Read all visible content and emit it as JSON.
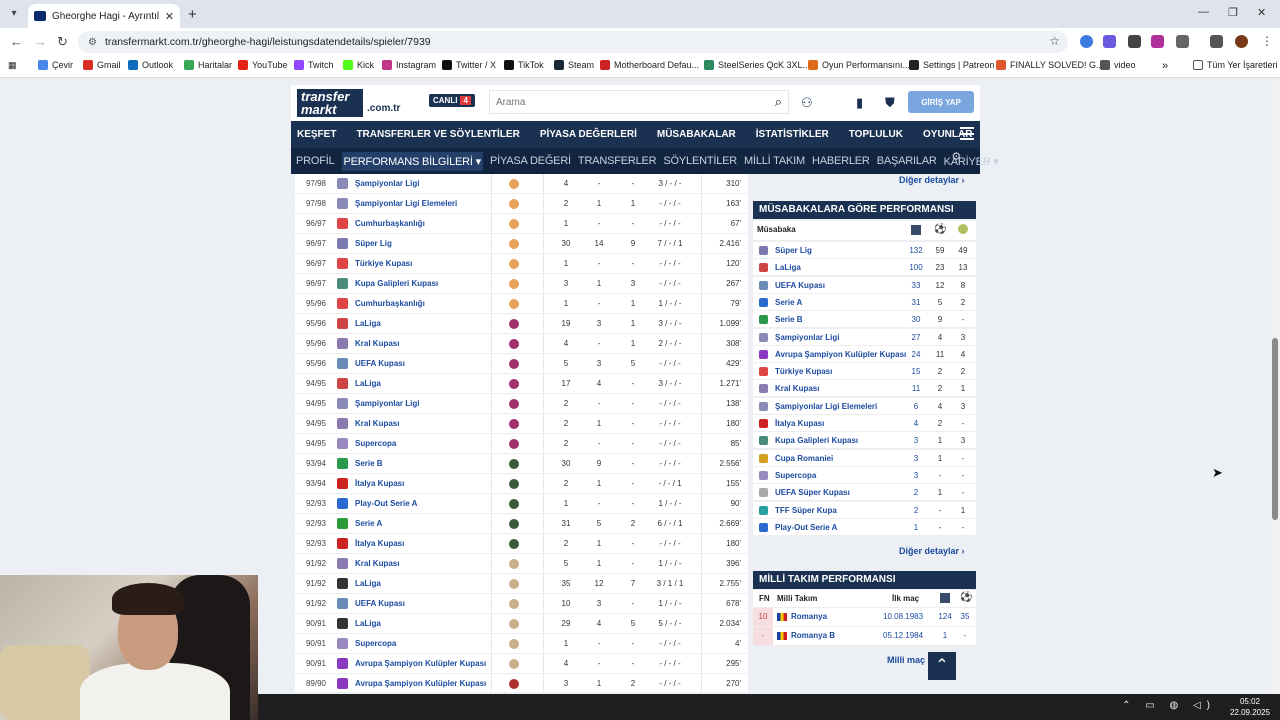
{
  "browser": {
    "tab_title": "Gheorghe Hagi - Ayrıntılı perfo",
    "url": "transfermarkt.com.tr/gheorghe-hagi/leistungsdatendetails/spieler/7939",
    "bookmarks": [
      "Çevir",
      "Gmail",
      "Outlook",
      "Haritalar",
      "YouTube",
      "Twitch",
      "Kick",
      "Instagram",
      "Twitter / X",
      "TikTok",
      "Steam",
      "Motherboard Defau...",
      "SteelSeries QcK 3XL...",
      "Oyun Performansını...",
      "Settings | Patreon",
      "FINALLY SOLVED! G...",
      "video"
    ],
    "more_bookmarks": "»",
    "all_bookmarks": "Tüm Yer İşaretleri",
    "bookmark_colors": [
      "#4a86e8",
      "#d93025",
      "#0f6cbd",
      "#34a853",
      "#e62117",
      "#9146ff",
      "#53fc18",
      "#c13584",
      "#111111",
      "#111111",
      "#1b2838",
      "#cc2222",
      "#2a8a5e",
      "#e06a1c",
      "#222222",
      "#e0562a",
      "#555555"
    ]
  },
  "header": {
    "logo": "transfer markt",
    "logo_domain": ".com.tr",
    "live": "CANLI",
    "live_count": "4",
    "search_placeholder": "Arama",
    "login": "GİRİŞ YAP"
  },
  "main_nav": [
    "KEŞFET",
    "TRANSFERLER VE SÖYLENTİLER",
    "PİYASA DEĞERLERİ",
    "MÜSABAKALAR",
    "İSTATİSTİKLER",
    "TOPLULUK",
    "OYUNLAR"
  ],
  "sub_nav": [
    "PROFİL",
    "PERFORMANS BİLGİLERİ ▾",
    "PİYASA DEĞERİ",
    "TRANSFERLER",
    "SÖYLENTİLER",
    "MİLLİ TAKIM",
    "HABERLER",
    "BAŞARILAR",
    "KARİYER ▾"
  ],
  "season_rows": [
    {
      "season": "97/98",
      "comp": "Şampiyonlar Ligi",
      "icon": "#8a8ab8",
      "club": "#e8a25a",
      "apps": "4",
      "goals": "-",
      "assists": "-",
      "cards": "3 / - / -",
      "mins": "310'"
    },
    {
      "season": "97/98",
      "comp": "Şampiyonlar Ligi Elemeleri",
      "icon": "#8a8ab8",
      "club": "#e8a25a",
      "apps": "2",
      "goals": "1",
      "assists": "1",
      "cards": "- / - / -",
      "mins": "163'"
    },
    {
      "season": "96/97",
      "comp": "Cumhurbaşkanlığı",
      "icon": "#d44",
      "club": "#e8a25a",
      "apps": "1",
      "goals": "-",
      "assists": "-",
      "cards": "- / - / -",
      "mins": "67'"
    },
    {
      "season": "96/97",
      "comp": "Süper Lig",
      "icon": "#7a7ab0",
      "club": "#e8a25a",
      "apps": "30",
      "goals": "14",
      "assists": "9",
      "cards": "7 / - / 1",
      "mins": "2.416'"
    },
    {
      "season": "96/97",
      "comp": "Türkiye Kupası",
      "icon": "#d44",
      "club": "#e8a25a",
      "apps": "1",
      "goals": "-",
      "assists": "-",
      "cards": "- / - / -",
      "mins": "120'"
    },
    {
      "season": "96/97",
      "comp": "Kupa Galipleri Kupası",
      "icon": "#4a8a7a",
      "club": "#e8a25a",
      "apps": "3",
      "goals": "1",
      "assists": "3",
      "cards": "- / - / -",
      "mins": "267'"
    },
    {
      "season": "95/96",
      "comp": "Cumhurbaşkanlığı",
      "icon": "#d44",
      "club": "#e8a25a",
      "apps": "1",
      "goals": "-",
      "assists": "1",
      "cards": "1 / - / -",
      "mins": "79'"
    },
    {
      "season": "95/96",
      "comp": "LaLiga",
      "icon": "#c44",
      "club": "#a0306a",
      "apps": "19",
      "goals": "3",
      "assists": "1",
      "cards": "3 / - / -",
      "mins": "1.099'"
    },
    {
      "season": "95/96",
      "comp": "Kral Kupası",
      "icon": "#8a7ab0",
      "club": "#a0306a",
      "apps": "4",
      "goals": "-",
      "assists": "1",
      "cards": "2 / - / -",
      "mins": "308'"
    },
    {
      "season": "95/96",
      "comp": "UEFA Kupası",
      "icon": "#6a8ab8",
      "club": "#a0306a",
      "apps": "5",
      "goals": "3",
      "assists": "5",
      "cards": "- / - / -",
      "mins": "429'"
    },
    {
      "season": "94/95",
      "comp": "LaLiga",
      "icon": "#c44",
      "club": "#a0306a",
      "apps": "17",
      "goals": "4",
      "assists": "-",
      "cards": "3 / - / -",
      "mins": "1.271'"
    },
    {
      "season": "94/95",
      "comp": "Şampiyonlar Ligi",
      "icon": "#8a8ab8",
      "club": "#a0306a",
      "apps": "2",
      "goals": "-",
      "assists": "-",
      "cards": "- / - / -",
      "mins": "138'"
    },
    {
      "season": "94/95",
      "comp": "Kral Kupası",
      "icon": "#8a7ab0",
      "club": "#a0306a",
      "apps": "2",
      "goals": "1",
      "assists": "-",
      "cards": "- / - / -",
      "mins": "180'"
    },
    {
      "season": "94/95",
      "comp": "Supercopa",
      "icon": "#9a8ac0",
      "club": "#a0306a",
      "apps": "2",
      "goals": "-",
      "assists": "-",
      "cards": "- / - / -",
      "mins": "85'"
    },
    {
      "season": "93/94",
      "comp": "Serie B",
      "icon": "#2a9a4a",
      "club": "#3a5a3a",
      "apps": "30",
      "goals": "9",
      "assists": "-",
      "cards": "- / - / -",
      "mins": "2.556'"
    },
    {
      "season": "93/94",
      "comp": "İtalya Kupası",
      "icon": "#c22",
      "club": "#3a5a3a",
      "apps": "2",
      "goals": "1",
      "assists": "-",
      "cards": "- / - / 1",
      "mins": "155'"
    },
    {
      "season": "92/93",
      "comp": "Play-Out Serie A",
      "icon": "#2a6ad0",
      "club": "#3a5a3a",
      "apps": "1",
      "goals": "-",
      "assists": "-",
      "cards": "1 / - / -",
      "mins": "90'"
    },
    {
      "season": "92/93",
      "comp": "Serie A",
      "icon": "#2a9a3a",
      "club": "#3a5a3a",
      "apps": "31",
      "goals": "5",
      "assists": "2",
      "cards": "6 / - / 1",
      "mins": "2.669'"
    },
    {
      "season": "92/93",
      "comp": "İtalya Kupası",
      "icon": "#c22",
      "club": "#3a5a3a",
      "apps": "2",
      "goals": "1",
      "assists": "-",
      "cards": "- / - / -",
      "mins": "180'"
    },
    {
      "season": "91/92",
      "comp": "Kral Kupası",
      "icon": "#8a7ab0",
      "club": "#c8b08a",
      "apps": "5",
      "goals": "1",
      "assists": "-",
      "cards": "1 / - / -",
      "mins": "396'"
    },
    {
      "season": "91/92",
      "comp": "LaLiga",
      "icon": "#333",
      "club": "#c8b08a",
      "apps": "35",
      "goals": "12",
      "assists": "7",
      "cards": "3 / 1 / 1",
      "mins": "2.755'"
    },
    {
      "season": "91/92",
      "comp": "UEFA Kupası",
      "icon": "#6a8ab8",
      "club": "#c8b08a",
      "apps": "10",
      "goals": "3",
      "assists": "-",
      "cards": "1 / - / -",
      "mins": "678'"
    },
    {
      "season": "90/91",
      "comp": "LaLiga",
      "icon": "#333",
      "club": "#c8b08a",
      "apps": "29",
      "goals": "4",
      "assists": "5",
      "cards": "5 / - / -",
      "mins": "2.034'"
    },
    {
      "season": "90/91",
      "comp": "Supercopa",
      "icon": "#9a8ac0",
      "club": "#c8b08a",
      "apps": "1",
      "goals": "-",
      "assists": "-",
      "cards": "- / - / -",
      "mins": "4'"
    },
    {
      "season": "90/91",
      "comp": "Avrupa Şampiyon Kulüpler Kupası",
      "icon": "#8a3ac0",
      "club": "#c8b08a",
      "apps": "4",
      "goals": "-",
      "assists": "-",
      "cards": "- / - / -",
      "mins": "295'"
    },
    {
      "season": "89/90",
      "comp": "Avrupa Şampiyon Kulüpler Kupası",
      "icon": "#8a3ac0",
      "club": "#b03030",
      "apps": "3",
      "goals": "1",
      "assists": "2",
      "cards": "- / - / -",
      "mins": "270'"
    }
  ],
  "details_link": "Diğer detaylar",
  "comp_panel": {
    "title": "MÜSABAKALARA GÖRE PERFORMANSI",
    "col": "Müsabaka",
    "rows": [
      {
        "name": "Süper Lig",
        "icon": "#7a7ab0",
        "apps": "132",
        "goals": "59",
        "assists": "49"
      },
      {
        "name": "LaLiga",
        "icon": "#c44",
        "apps": "100",
        "goals": "23",
        "assists": "13"
      },
      {
        "name": "UEFA Kupası",
        "icon": "#6a8ab8",
        "apps": "33",
        "goals": "12",
        "assists": "8"
      },
      {
        "name": "Serie A",
        "icon": "#2a6ad0",
        "apps": "31",
        "goals": "5",
        "assists": "2"
      },
      {
        "name": "Serie B",
        "icon": "#2a9a4a",
        "apps": "30",
        "goals": "9",
        "assists": "-"
      },
      {
        "name": "Şampiyonlar Ligi",
        "icon": "#8a8ab8",
        "apps": "27",
        "goals": "4",
        "assists": "3"
      },
      {
        "name": "Avrupa Şampiyon Kulüpler Kupası",
        "icon": "#8a3ac0",
        "apps": "24",
        "goals": "11",
        "assists": "4"
      },
      {
        "name": "Türkiye Kupası",
        "icon": "#d44",
        "apps": "15",
        "goals": "2",
        "assists": "2"
      },
      {
        "name": "Kral Kupası",
        "icon": "#8a7ab0",
        "apps": "11",
        "goals": "2",
        "assists": "1"
      },
      {
        "name": "Şampiyonlar Ligi Elemeleri",
        "icon": "#8a8ab8",
        "apps": "6",
        "goals": "4",
        "assists": "3"
      },
      {
        "name": "İtalya Kupası",
        "icon": "#c22",
        "apps": "4",
        "goals": "2",
        "assists": "-"
      },
      {
        "name": "Kupa Galipleri Kupası",
        "icon": "#4a8a7a",
        "apps": "3",
        "goals": "1",
        "assists": "3"
      },
      {
        "name": "Cupa Romaniei",
        "icon": "#d4a020",
        "apps": "3",
        "goals": "1",
        "assists": "-"
      },
      {
        "name": "Supercopa",
        "icon": "#9a8ac0",
        "apps": "3",
        "goals": "-",
        "assists": "-"
      },
      {
        "name": "UEFA Süper Kupası",
        "icon": "#aaa",
        "apps": "2",
        "goals": "1",
        "assists": "-"
      },
      {
        "name": "TFF Süper Kupa",
        "icon": "#2aa0a0",
        "apps": "2",
        "goals": "-",
        "assists": "1"
      },
      {
        "name": "Play-Out Serie A",
        "icon": "#2a6ad0",
        "apps": "1",
        "goals": "-",
        "assists": "-"
      }
    ]
  },
  "nat_panel": {
    "title": "MİLLİ TAKIM PERFORMANSI",
    "cols": {
      "fn": "FN",
      "team": "Milli Takım",
      "first": "İlk maç"
    },
    "rows": [
      {
        "fn": "10",
        "team": "Romanya",
        "first": "10.08.1983",
        "apps": "124",
        "goals": "35"
      },
      {
        "fn": "-",
        "team": "Romanya B",
        "first": "05.12.1984",
        "apps": "1",
        "goals": "-"
      }
    ],
    "link": "Milli maç k"
  },
  "taskbar": {
    "time": "05:02",
    "date": "22.09.2025"
  }
}
